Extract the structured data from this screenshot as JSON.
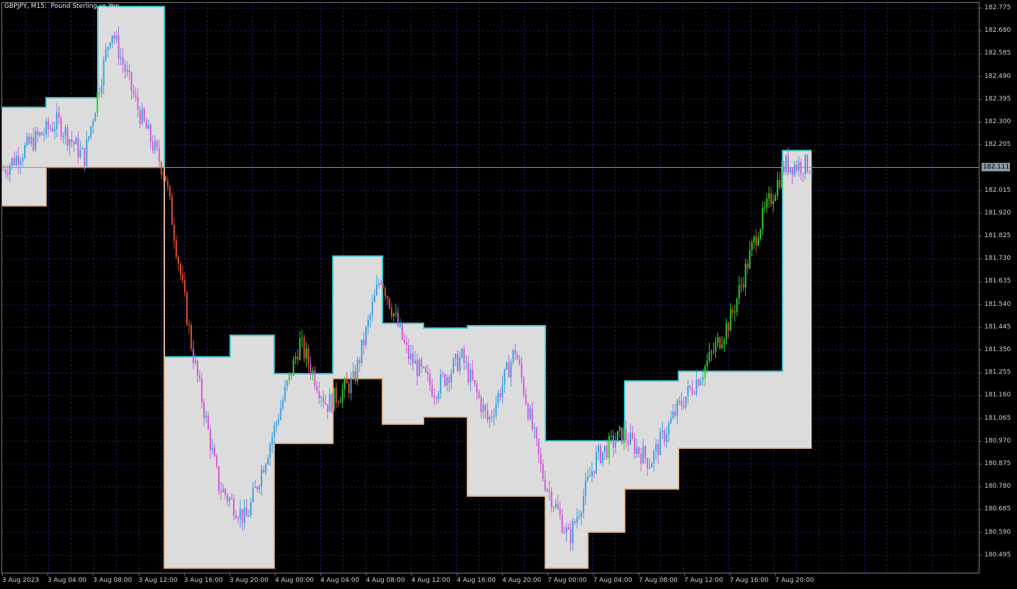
{
  "window": {
    "title": "GBPJPY, M15:  Pound Sterling vs Yen",
    "symbol": "GBPJPY",
    "timeframe": "M15",
    "description": "Pound Sterling vs Yen"
  },
  "colors": {
    "background": "#000000",
    "grid": "#1c1c5a",
    "channel_fill": "#dcdcdc",
    "channel_upper": "#3fc9d6",
    "channel_lower": "#e0b890",
    "candle_up_above": "#3aa0e0",
    "candle_down_below": "#d05ad8",
    "candle_up": "#33cc33",
    "candle_down": "#e05030",
    "current_price_line": "#8a9aa8",
    "current_price_tag": "#8a9aa8"
  },
  "price_axis": {
    "labels": [
      "182.775",
      "182.680",
      "182.585",
      "182.490",
      "182.395",
      "182.300",
      "182.205",
      "182.015",
      "181.920",
      "181.825",
      "181.730",
      "181.635",
      "181.540",
      "181.445",
      "181.350",
      "181.255",
      "181.160",
      "181.065",
      "180.970",
      "180.875",
      "180.780",
      "180.685",
      "180.590",
      "180.495"
    ],
    "current_price": "182.111",
    "range": [
      180.44,
      182.79
    ]
  },
  "time_axis": {
    "labels": [
      "3 Aug 2023",
      "3 Aug 04:00",
      "3 Aug 08:00",
      "3 Aug 12:00",
      "3 Aug 16:00",
      "3 Aug 20:00",
      "4 Aug 00:00",
      "4 Aug 04:00",
      "4 Aug 08:00",
      "4 Aug 12:00",
      "4 Aug 16:00",
      "4 Aug 20:00",
      "7 Aug 00:00",
      "7 Aug 04:00",
      "7 Aug 08:00",
      "7 Aug 12:00",
      "7 Aug 16:00",
      "7 Aug 20:00"
    ]
  },
  "chart_data": {
    "type": "candlestick-channel",
    "channel_segments": [
      {
        "upper": 182.36,
        "lower": 181.95
      },
      {
        "upper": 182.4,
        "lower": 182.11
      },
      {
        "upper": 182.78,
        "lower": 182.11
      },
      {
        "upper": 181.32,
        "lower": 180.44
      },
      {
        "upper": 181.41,
        "lower": 180.44
      },
      {
        "upper": 181.25,
        "lower": 180.96
      },
      {
        "upper": 181.74,
        "lower": 181.23
      },
      {
        "upper": 181.46,
        "lower": 181.04
      },
      {
        "upper": 181.44,
        "lower": 181.07
      },
      {
        "upper": 181.45,
        "lower": 180.74
      },
      {
        "upper": 180.97,
        "lower": 180.44
      },
      {
        "upper": 180.97,
        "lower": 180.59
      },
      {
        "upper": 181.22,
        "lower": 180.77
      },
      {
        "upper": 181.26,
        "lower": 180.94
      },
      {
        "upper": 182.18,
        "lower": 180.94
      }
    ],
    "price_path": [
      {
        "t": 0,
        "p": 182.1
      },
      {
        "t": 1,
        "p": 182.21
      },
      {
        "t": 2,
        "p": 182.3
      },
      {
        "t": 3,
        "p": 182.15
      },
      {
        "t": 4,
        "p": 182.69
      },
      {
        "t": 5,
        "p": 182.35
      },
      {
        "t": 6,
        "p": 182.08
      },
      {
        "t": 7,
        "p": 181.35
      },
      {
        "t": 8,
        "p": 180.78
      },
      {
        "t": 9,
        "p": 180.64
      },
      {
        "t": 10,
        "p": 181.0
      },
      {
        "t": 11,
        "p": 181.38
      },
      {
        "t": 12,
        "p": 181.12
      },
      {
        "t": 13,
        "p": 181.22
      },
      {
        "t": 14,
        "p": 181.66
      },
      {
        "t": 15,
        "p": 181.33
      },
      {
        "t": 16,
        "p": 181.18
      },
      {
        "t": 17,
        "p": 181.32
      },
      {
        "t": 18,
        "p": 181.05
      },
      {
        "t": 19,
        "p": 181.35
      },
      {
        "t": 20,
        "p": 180.83
      },
      {
        "t": 21,
        "p": 180.56
      },
      {
        "t": 22,
        "p": 180.9
      },
      {
        "t": 23,
        "p": 181.0
      },
      {
        "t": 24,
        "p": 180.88
      },
      {
        "t": 25,
        "p": 181.1
      },
      {
        "t": 26,
        "p": 181.27
      },
      {
        "t": 27,
        "p": 181.48
      },
      {
        "t": 28,
        "p": 181.85
      },
      {
        "t": 29,
        "p": 182.12
      },
      {
        "t": 30,
        "p": 182.12
      }
    ],
    "current_price": 182.111
  }
}
